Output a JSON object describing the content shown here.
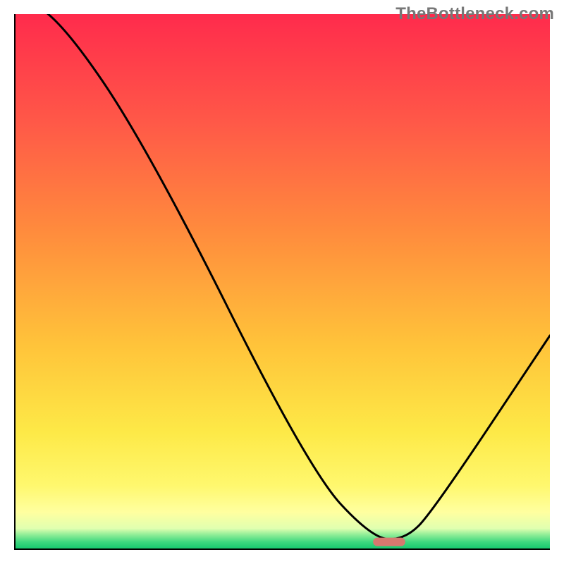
{
  "watermark": "TheBottleneck.com",
  "chart_data": {
    "type": "line",
    "title": "",
    "xlabel": "",
    "ylabel": "",
    "xlim": [
      0,
      100
    ],
    "ylim": [
      0,
      100
    ],
    "grid": false,
    "legend": false,
    "series": [
      {
        "name": "bottleneck-curve",
        "x": [
          0,
          8,
          25,
          55,
          67,
          73,
          78,
          100
        ],
        "values": [
          103,
          100,
          75,
          15,
          2,
          2,
          7,
          40
        ]
      }
    ],
    "marker": {
      "name": "optimal-range-marker",
      "x_start": 67,
      "x_end": 73,
      "y": 1.5,
      "color": "#d7786f"
    },
    "gradient_stops": [
      {
        "offset": 0,
        "color": "#ff2b4c"
      },
      {
        "offset": 0.2,
        "color": "#ff5848"
      },
      {
        "offset": 0.4,
        "color": "#ff8a3d"
      },
      {
        "offset": 0.62,
        "color": "#ffc43a"
      },
      {
        "offset": 0.78,
        "color": "#fde947"
      },
      {
        "offset": 0.88,
        "color": "#fff86e"
      },
      {
        "offset": 0.93,
        "color": "#ffffa0"
      },
      {
        "offset": 0.96,
        "color": "#e0ffb0"
      },
      {
        "offset": 0.97,
        "color": "#9bf09a"
      },
      {
        "offset": 0.985,
        "color": "#3fd87f"
      },
      {
        "offset": 1.0,
        "color": "#0fc46c"
      }
    ],
    "curve_stroke": {
      "color": "#000000",
      "width": 3
    },
    "axes_stroke": {
      "color": "#000000",
      "width": 4
    }
  }
}
